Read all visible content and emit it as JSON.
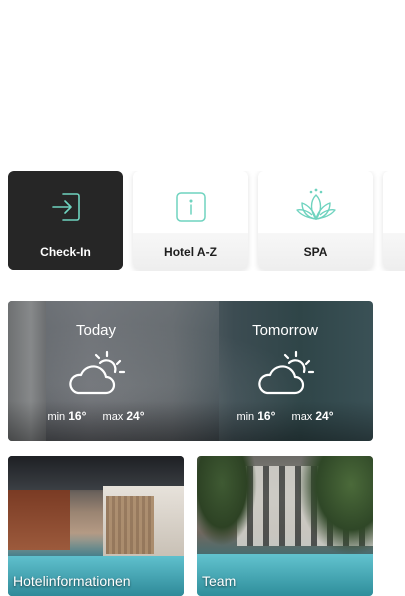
{
  "quick_actions": [
    {
      "label": "Check-In",
      "icon": "login-arrow-icon",
      "active": true
    },
    {
      "label": "Hotel A-Z",
      "icon": "info-icon",
      "active": false
    },
    {
      "label": "SPA",
      "icon": "lotus-icon",
      "active": false
    }
  ],
  "weather": {
    "today": {
      "title": "Today",
      "min_label": "min",
      "min": "16°",
      "max_label": "max",
      "max": "24°",
      "icon": "partly-sunny-icon"
    },
    "tomorrow": {
      "title": "Tomorrow",
      "min_label": "min",
      "min": "16°",
      "max_label": "max",
      "max": "24°",
      "icon": "partly-sunny-icon"
    }
  },
  "cards": [
    {
      "label": "Hotelinformationen"
    },
    {
      "label": "Team"
    }
  ],
  "colors": {
    "accent": "#6fd3bf",
    "dark_tile": "#262626"
  }
}
